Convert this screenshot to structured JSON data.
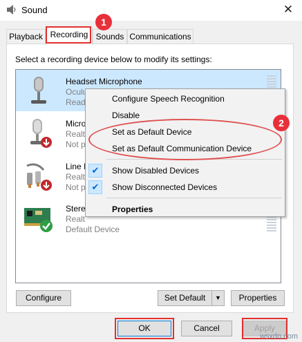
{
  "window": {
    "title": "Sound",
    "close_glyph": "✕",
    "icon": "speaker-icon"
  },
  "tabs": [
    {
      "label": "Playback",
      "active": false
    },
    {
      "label": "Recording",
      "active": true
    },
    {
      "label": "Sounds",
      "active": false
    },
    {
      "label": "Communications",
      "active": false
    }
  ],
  "instruction": "Select a recording device below to modify its settings:",
  "devices": [
    {
      "name": "Headset Microphone",
      "sub": "Oculu",
      "status": "Read",
      "icon": "headset-microphone-icon",
      "selected": true
    },
    {
      "name": "Micro",
      "sub": "Realt",
      "status": "Not p",
      "icon": "microphone-icon",
      "selected": false
    },
    {
      "name": "Line I",
      "sub": "Realt",
      "status": "Not p",
      "icon": "line-in-icon",
      "selected": false
    },
    {
      "name": "Stere",
      "sub": "Realt",
      "status": "Default Device",
      "icon": "sound-card-icon",
      "selected": false
    }
  ],
  "context_menu": {
    "items": [
      {
        "label": "Configure Speech Recognition",
        "checked": false,
        "bold": false
      },
      {
        "label": "Disable",
        "checked": false,
        "bold": false
      },
      {
        "label": "Set as Default Device",
        "checked": false,
        "bold": false
      },
      {
        "label": "Set as Default Communication Device",
        "checked": false,
        "bold": false
      },
      {
        "label": "Show Disabled Devices",
        "checked": true,
        "bold": false
      },
      {
        "label": "Show Disconnected Devices",
        "checked": true,
        "bold": false
      },
      {
        "label": "Properties",
        "checked": false,
        "bold": true
      }
    ],
    "check_glyph": "✔"
  },
  "buttons": {
    "configure": "Configure",
    "set_default": "Set Default",
    "set_default_arrow": "▼",
    "properties": "Properties",
    "ok": "OK",
    "cancel": "Cancel",
    "apply": "Apply"
  },
  "annotations": {
    "step1": "1",
    "step2": "2",
    "color": "#e8303a"
  },
  "watermark": "wsxdn.com",
  "colors": {
    "selection": "#cce8ff",
    "dialog_bg": "#f0f0f0",
    "accent": "#0066cc"
  }
}
